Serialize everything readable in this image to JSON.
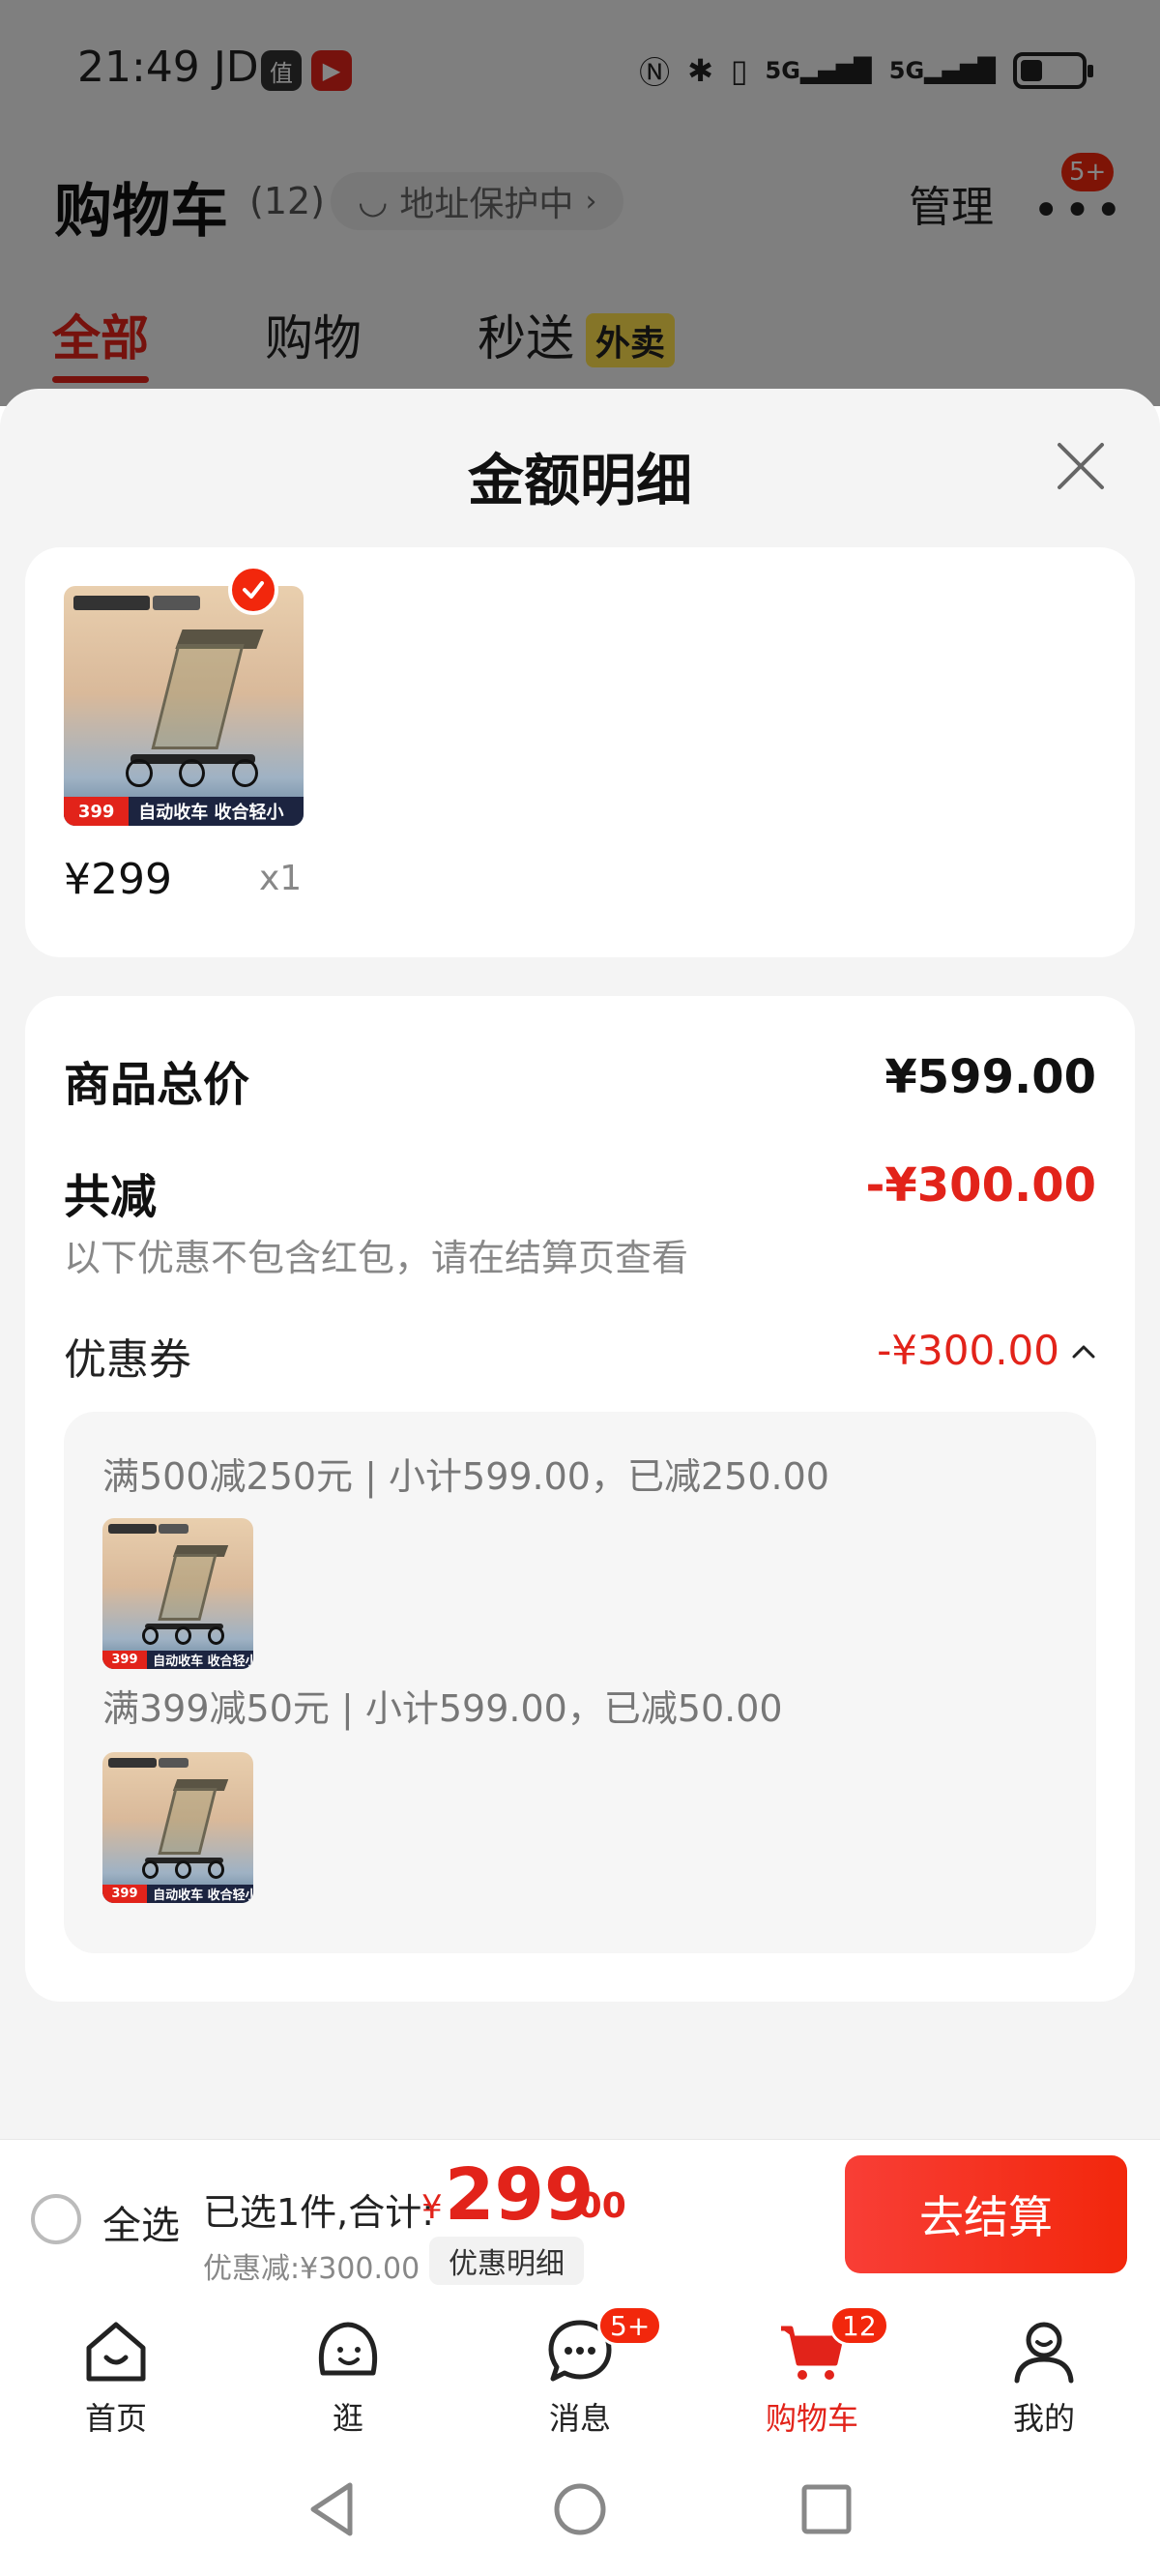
{
  "status_bar": {
    "time": "21:49",
    "carrier": "JD",
    "badge1": "值",
    "badge1_color": "#333333",
    "badge2_color": "#e2231a",
    "signal1": "5G",
    "signal2": "5G"
  },
  "cart_header": {
    "title": "购物车",
    "count": "(12)",
    "address": "地址保护中",
    "manage": "管理",
    "more_badge": "5+"
  },
  "tabs": [
    {
      "label": "全部",
      "active": true
    },
    {
      "label": "购物",
      "active": false
    },
    {
      "label": "秒送",
      "tag": "外卖",
      "active": false
    }
  ],
  "sheet": {
    "title": "金额明细",
    "item": {
      "price": "¥299",
      "qty": "x1",
      "thumb_price": "399",
      "thumb_caption": "自动收车 收合轻小"
    },
    "summary": {
      "total_label": "商品总价",
      "total_value": "¥599.00",
      "discount_label": "共减",
      "discount_value": "-¥300.00",
      "note": "以下优惠不包含红包，请在结算页查看",
      "coupon_label": "优惠券",
      "coupon_value": "-¥300.00"
    },
    "coupons": [
      {
        "line": "满500减250元 | 小计599.00，已减250.00"
      },
      {
        "line": "满399减50元 | 小计599.00，已减50.00"
      }
    ]
  },
  "checkout": {
    "select_all": "全选",
    "selected": "已选1件,合计:",
    "yen": "¥",
    "total_int": "299",
    "total_dec": ".00",
    "discount": "优惠减:¥300.00",
    "detail_button": "优惠明细",
    "pay_button": "去结算"
  },
  "tab_bar": [
    {
      "label": "首页",
      "icon": "home-icon"
    },
    {
      "label": "逛",
      "icon": "explore-icon"
    },
    {
      "label": "消息",
      "icon": "message-icon",
      "badge": "5+"
    },
    {
      "label": "购物车",
      "icon": "cart-icon",
      "badge": "12",
      "active": true
    },
    {
      "label": "我的",
      "icon": "profile-icon"
    }
  ],
  "colors": {
    "accent": "#e2231a",
    "sheet_bg": "#f4f4f4"
  }
}
